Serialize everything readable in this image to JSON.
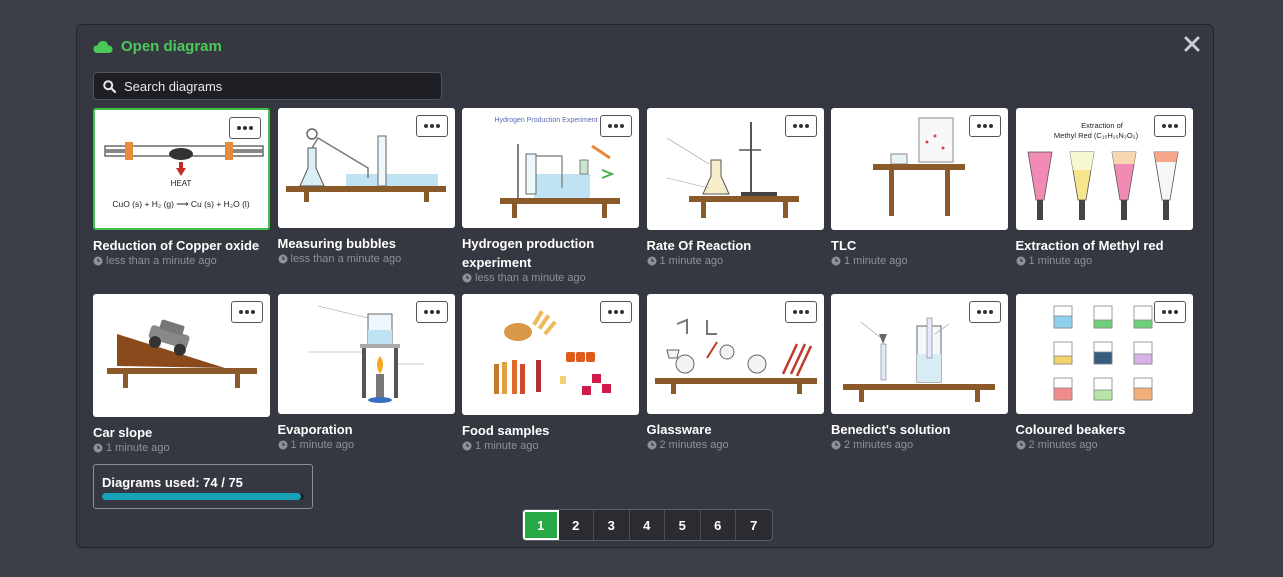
{
  "dialog": {
    "title": "Open diagram",
    "search_placeholder": "Search diagrams"
  },
  "diagrams": [
    {
      "name": "Reduction of Copper oxide",
      "time": "less than a minute ago",
      "selected": true,
      "thumb_text": [
        "HEAT",
        "CuO (s) + H₂ (g) ⟶ Cu (s) + H₂O (l)"
      ]
    },
    {
      "name": "Measuring bubbles",
      "time": "less than a minute ago"
    },
    {
      "name": "Hydrogen production experiment",
      "time": "less than a minute ago",
      "thumb_text": [
        "Hydrogen Production Experiment"
      ]
    },
    {
      "name": "Rate Of Reaction",
      "time": "1 minute ago"
    },
    {
      "name": "TLC",
      "time": "1 minute ago"
    },
    {
      "name": "Extraction of Methyl red",
      "time": "1 minute ago",
      "thumb_text": [
        "Extraction of",
        "Methyl Red (C₁₅H₁₅N₃O₂)"
      ]
    },
    {
      "name": "Car slope",
      "time": "1 minute ago"
    },
    {
      "name": "Evaporation",
      "time": "1 minute ago"
    },
    {
      "name": "Food samples",
      "time": "1 minute ago"
    },
    {
      "name": "Glassware",
      "time": "2 minutes ago"
    },
    {
      "name": "Benedict's solution",
      "time": "2 minutes ago"
    },
    {
      "name": "Coloured beakers",
      "time": "2 minutes ago"
    }
  ],
  "usage": {
    "label": "Diagrams used: 74 / 75",
    "used": 74,
    "total": 75
  },
  "pagination": {
    "pages": [
      "1",
      "2",
      "3",
      "4",
      "5",
      "6",
      "7"
    ],
    "current": "1"
  },
  "colors": {
    "accent": "#4cc95a",
    "selected_border": "#3ec14b",
    "progress": "#17a2b8",
    "active_page": "#28a745"
  }
}
